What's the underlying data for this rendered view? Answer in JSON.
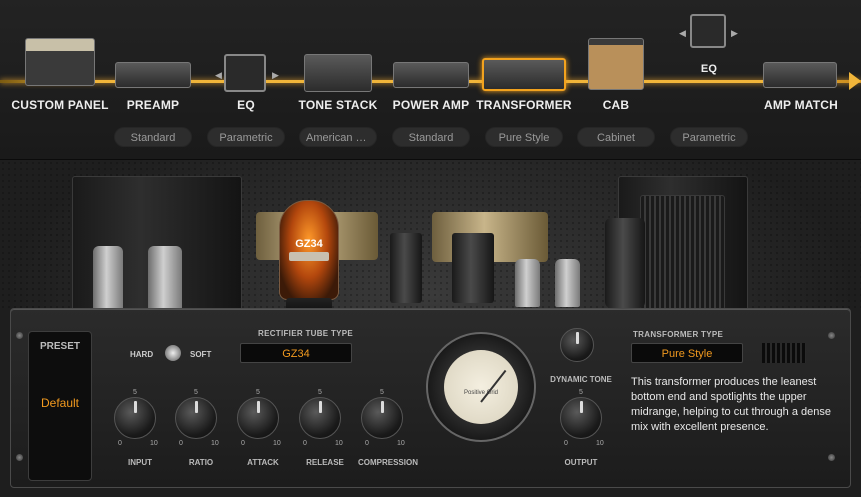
{
  "chain": {
    "modules": [
      {
        "label": "CUSTOM PANEL",
        "setting": ""
      },
      {
        "label": "PREAMP",
        "setting": "Standard"
      },
      {
        "label": "EQ",
        "setting": "Parametric"
      },
      {
        "label": "TONE STACK",
        "setting": "American Cl..."
      },
      {
        "label": "POWER AMP",
        "setting": "Standard"
      },
      {
        "label": "TRANSFORMER",
        "setting": "Pure Style"
      },
      {
        "label": "CAB",
        "setting": "Cabinet"
      },
      {
        "label": "EQ",
        "setting": "Parametric"
      },
      {
        "label": "AMP MATCH",
        "setting": ""
      }
    ],
    "selected": "TRANSFORMER",
    "accent_color": "#f2a21e"
  },
  "tube": {
    "label": "GZ34"
  },
  "preset": {
    "title": "PRESET",
    "value": "Default"
  },
  "rectifier": {
    "hard_label": "HARD",
    "soft_label": "SOFT",
    "tube_type_label": "RECTIFIER TUBE TYPE",
    "tube_type_value": "GZ34"
  },
  "knobs": [
    {
      "label": "INPUT",
      "min": "0",
      "mid": "5",
      "max": "10"
    },
    {
      "label": "RATIO",
      "min": "0",
      "mid": "5",
      "max": "10"
    },
    {
      "label": "ATTACK",
      "min": "0",
      "mid": "5",
      "max": "10"
    },
    {
      "label": "RELEASE",
      "min": "0",
      "mid": "5",
      "max": "10"
    },
    {
      "label": "COMPRESSION",
      "min": "0",
      "mid": "5",
      "max": "10"
    }
  ],
  "meter": {
    "label": "Positive Grid"
  },
  "dynamic_tone": {
    "label": "DYNAMIC TONE"
  },
  "output": {
    "label": "OUTPUT",
    "min": "0",
    "mid": "5",
    "max": "10"
  },
  "transformer": {
    "type_label": "TRANSFORMER TYPE",
    "type_value": "Pure Style",
    "description": "This transformer produces the leanest bottom end and spotlights the upper midrange, helping to cut through a dense mix with excellent presence."
  }
}
